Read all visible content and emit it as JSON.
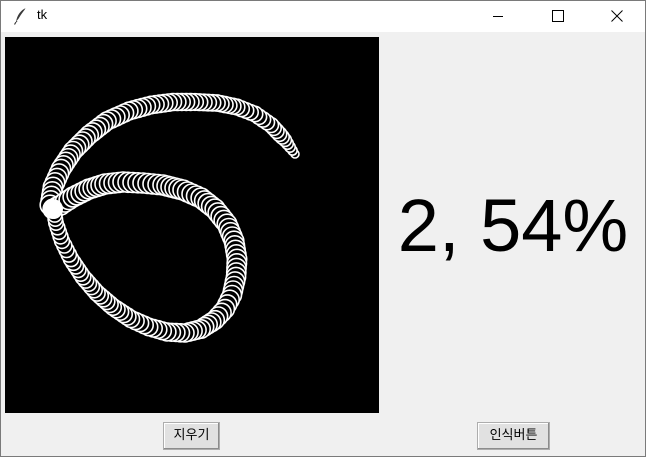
{
  "window": {
    "title": "tk",
    "icon": "feather-icon",
    "controls": [
      "minimize-icon",
      "maximize-icon",
      "close-icon"
    ]
  },
  "canvas": {
    "background": "#000000",
    "stroke_color": "#ffffff",
    "drawn_digit": "6"
  },
  "result": {
    "text": "2, 54%"
  },
  "buttons": {
    "clear_label": "지우기",
    "recognize_label": "인식버튼"
  }
}
